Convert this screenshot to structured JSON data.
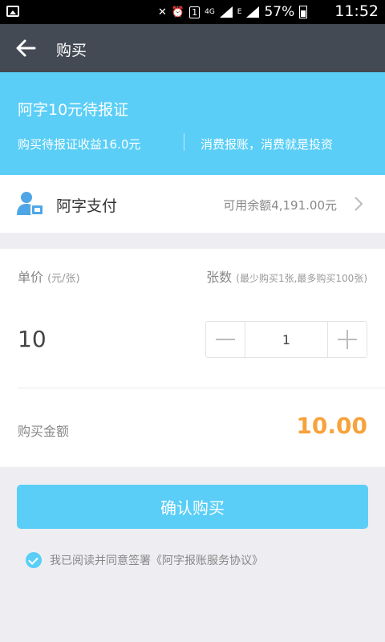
{
  "status_bar": {
    "network": "4G",
    "sim": "1",
    "data_type": "E",
    "battery": "57%",
    "time": "11:52"
  },
  "navbar": {
    "title": "购买"
  },
  "hero": {
    "title": "阿字10元待报证",
    "earnings": "购买待报证收益16.0元",
    "slogan": "消费报账，消费就是投资"
  },
  "payment": {
    "method": "阿字支付",
    "balance": "可用余额4,191.00元"
  },
  "order": {
    "price_label": "单价",
    "price_unit": "(元/张)",
    "quantity_label": "张数",
    "quantity_rule": "(最少购买1张,最多购买100张)",
    "price_value": "10",
    "quantity": "1",
    "amount_label": "购买金额",
    "amount_value": "10.00"
  },
  "confirm_label": "确认购买",
  "agreement": {
    "checked": true,
    "text": "我已阅读并同意签署《阿字报账服务协议》"
  },
  "colors": {
    "accent": "#5acef7",
    "navbar": "#434a54",
    "amount": "#f7a23c",
    "background": "#eeeef2"
  }
}
